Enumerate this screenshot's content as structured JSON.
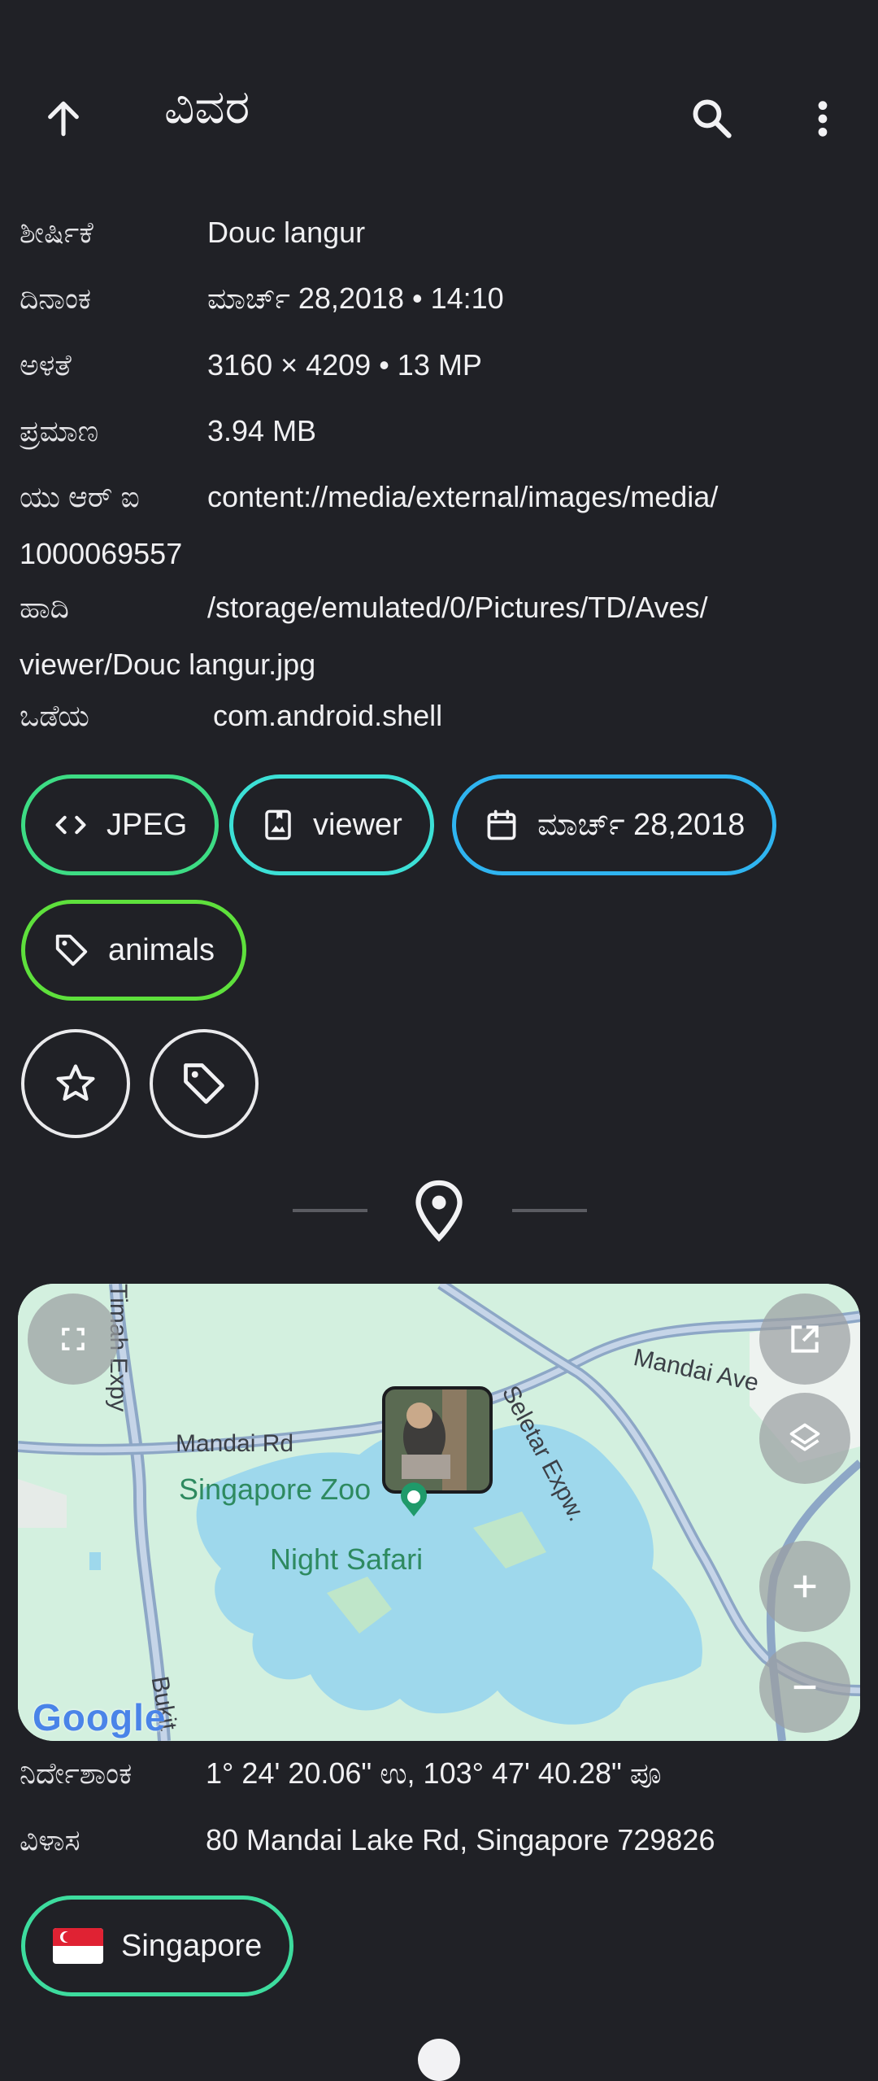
{
  "app_bar": {
    "title": "ವಿವರ",
    "icons": [
      "arrow-up-icon",
      "search-icon",
      "more-vert-icon"
    ]
  },
  "details": [
    {
      "label": "ಶೀರ್ಷಿಕೆ",
      "value": "Douc langur"
    },
    {
      "label": "ದಿನಾಂಕ",
      "value": "ಮಾರ್ಚ್ 28,2018 • 14:10"
    },
    {
      "label": "ಅಳತೆ",
      "value": "3160 × 4209 • 13 MP"
    },
    {
      "label": "ಪ್ರಮಾಣ",
      "value": "3.94 MB"
    },
    {
      "label": "ಯು ಆರ್ ಐ",
      "value": "content://media/external/images/media/",
      "value_cont": "1000069557"
    },
    {
      "label": "ಹಾದಿ",
      "value": "/storage/emulated/0/Pictures/TD/Aves/",
      "value_cont": "viewer/Douc langur.jpg"
    },
    {
      "label": "ಒಡೆಯ",
      "value": "com.android.shell"
    }
  ],
  "chips": [
    {
      "label": "JPEG",
      "icon": "code-icon",
      "color": "#3ddc84"
    },
    {
      "label": "viewer",
      "icon": "photo-album-icon",
      "color": "#3ce0d6"
    },
    {
      "label": "ಮಾರ್ಚ್ 28,2018",
      "icon": "calendar-icon",
      "color": "#2fb4f0"
    },
    {
      "label": "animals",
      "icon": "tag-icon",
      "color": "#5ee03c"
    }
  ],
  "action_icons": [
    "star-outline-icon",
    "tag-outline-icon"
  ],
  "map": {
    "labels": {
      "road1": "Mandai Rd",
      "road2": "Mandai Ave",
      "road3": "Seletar Expw.",
      "road4": "Timah Expy",
      "road5": "Bukit",
      "poi1": "Singapore Zoo",
      "poi2": "Night Safari",
      "google": "Google"
    },
    "controls": [
      "fullscreen-icon",
      "open-external-icon",
      "layers-icon",
      "zoom-in-icon",
      "zoom-out-icon"
    ]
  },
  "location": [
    {
      "label": "ನಿರ್ದೇಶಾಂಕ",
      "value": "1° 24' 20.06\" ಉ, 103° 47' 40.28\" ಪೂ"
    },
    {
      "label": "ವಿಳಾಸ",
      "value": "80 Mandai Lake Rd, Singapore 729826"
    }
  ],
  "country_chip": {
    "flag": "🇸🇬",
    "label": "Singapore",
    "color": "#3ddc9e"
  },
  "colors": {
    "background": "#202126",
    "text": "#f0f0f2"
  }
}
